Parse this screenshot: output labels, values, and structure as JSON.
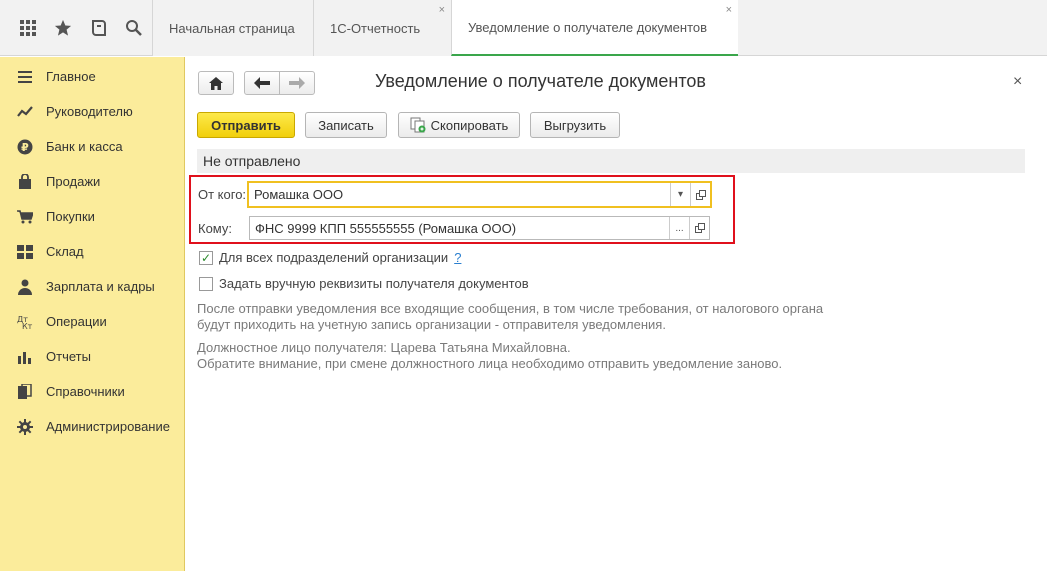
{
  "topbar": {
    "icons": [
      "apps-grid-icon",
      "star-icon",
      "history-icon",
      "search-icon"
    ],
    "tabs": [
      {
        "label": "Начальная страница",
        "closable": false,
        "active": false
      },
      {
        "label": "1С-Отчетность",
        "closable": true,
        "active": false
      },
      {
        "label": "Уведомление о получателе документов",
        "closable": true,
        "active": true
      }
    ],
    "close_glyph": "×"
  },
  "sidebar": {
    "items": [
      {
        "label": "Главное",
        "icon": "menu-lines-icon"
      },
      {
        "label": "Руководителю",
        "icon": "trend-icon"
      },
      {
        "label": "Банк и касса",
        "icon": "ruble-icon"
      },
      {
        "label": "Продажи",
        "icon": "bag-icon"
      },
      {
        "label": "Покупки",
        "icon": "cart-icon"
      },
      {
        "label": "Склад",
        "icon": "warehouse-icon"
      },
      {
        "label": "Зарплата и кадры",
        "icon": "person-icon"
      },
      {
        "label": "Операции",
        "icon": "dt-kt-icon"
      },
      {
        "label": "Отчеты",
        "icon": "bar-chart-icon"
      },
      {
        "label": "Справочники",
        "icon": "books-icon"
      },
      {
        "label": "Администрирование",
        "icon": "gear-icon"
      }
    ]
  },
  "document": {
    "title": "Уведомление о получателе документов",
    "close_glyph": "×",
    "toolbar": {
      "send": "Отправить",
      "save": "Записать",
      "copy": "Скопировать",
      "export": "Выгрузить"
    },
    "status": "Не отправлено",
    "from_label": "От кого:",
    "from_value": "Ромашка ООО",
    "to_label": "Кому:",
    "to_value": "ФНС 9999 КПП 555555555 (Ромашка ООО)",
    "dropdown_glyph": "▾",
    "ellipsis_glyph": "...",
    "checkbox_all_units": {
      "label": "Для всех подразделений организации",
      "checked": true,
      "help": "?"
    },
    "checkbox_manual": {
      "label": "Задать вручную реквизиты получателя документов",
      "checked": false
    },
    "note1": [
      "После отправки уведомления все входящие сообщения, в том числе требования, от налогового органа",
      "будут приходить на учетную запись организации - отправителя уведомления."
    ],
    "note2": [
      "Должностное лицо получателя: Царева Татьяна Михайловна.",
      "Обратите внимание, при смене должностного лица необходимо отправить уведомление заново."
    ]
  },
  "colors": {
    "sidebar_bg": "#fbec9b",
    "primary_button": "#f1cf0c",
    "highlight_box": "#e0101c",
    "focus_border": "#f0c020",
    "active_tab_underline": "#3aa64b"
  }
}
